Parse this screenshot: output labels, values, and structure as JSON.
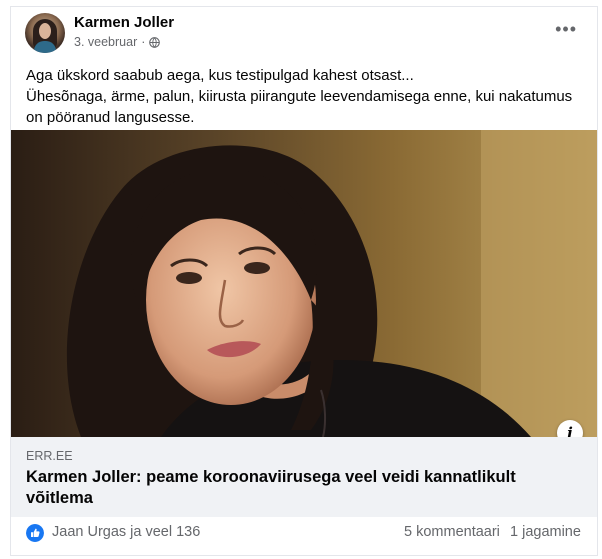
{
  "post": {
    "author": "Karmen Joller",
    "date": "3. veebruar",
    "separator": "·",
    "privacy_icon": "globe-icon",
    "more_icon": "more-options-icon",
    "more_symbol": "•••",
    "text_lines": [
      "Aga ükskord saabub aega, kus testipulgad kahest otsast...",
      "Ühesõnaga, ärme, palun, kiirusta piirangute leevendamisega enne, kui nakatumus on pööranud langusesse."
    ]
  },
  "link_preview": {
    "info_icon": "info-icon",
    "info_symbol": "i",
    "domain": "ERR.EE",
    "title": "Karmen Joller: peame koroonaviirusega veel veidi kannatlikult võitlema"
  },
  "footer": {
    "reaction_icon": "like-reaction-icon",
    "reactions_text": "Jaan Urgas ja veel 136",
    "comments_text": "5 kommentaari",
    "shares_text": "1 jagamine"
  },
  "colors": {
    "facebook_blue": "#1877f2",
    "secondary_text": "#65676b",
    "link_box_bg": "#f0f2f5"
  }
}
